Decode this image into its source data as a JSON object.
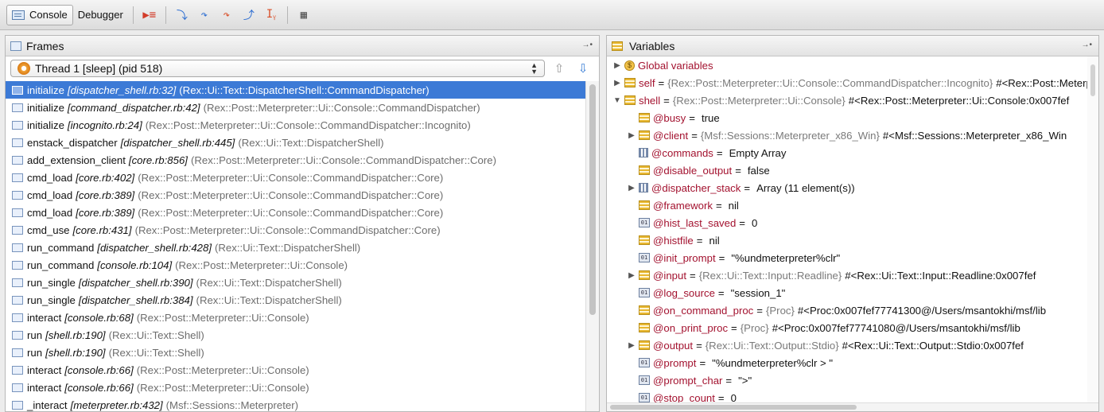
{
  "toolbar": {
    "tabs": [
      {
        "label": "Console",
        "icon": "console-icon",
        "active": true
      },
      {
        "label": "Debugger",
        "active": false
      }
    ],
    "buttons": [
      {
        "name": "run-to-cursor-button",
        "glyph": "▶≡",
        "color": "#d23c2a"
      },
      {
        "name": "step-into-button",
        "glyph": "⤵",
        "color": "#2f6fd2"
      },
      {
        "name": "step-over-button",
        "glyph": "↷",
        "color": "#2f6fd2"
      },
      {
        "name": "step-out-button",
        "glyph": "↷",
        "color": "#d9502a"
      },
      {
        "name": "step-out-frame-button",
        "glyph": "⤴",
        "color": "#2f6fd2"
      },
      {
        "name": "evaluate-expression-button",
        "glyph": "Iᵧ",
        "color": "#d9502a"
      },
      {
        "name": "calculator-button",
        "glyph": "▦",
        "color": "#555555"
      }
    ]
  },
  "frames_panel": {
    "title": "Frames",
    "thread": "Thread 1 [sleep] (pid 518)",
    "frames": [
      {
        "method": "initialize",
        "loc": "[dispatcher_shell.rb:32]",
        "cls": "(Rex::Ui::Text::DispatcherShell::CommandDispatcher)",
        "selected": true
      },
      {
        "method": "initialize",
        "loc": "[command_dispatcher.rb:42]",
        "cls": "(Rex::Post::Meterpreter::Ui::Console::CommandDispatcher)"
      },
      {
        "method": "initialize",
        "loc": "[incognito.rb:24]",
        "cls": "(Rex::Post::Meterpreter::Ui::Console::CommandDispatcher::Incognito)"
      },
      {
        "method": "enstack_dispatcher",
        "loc": "[dispatcher_shell.rb:445]",
        "cls": "(Rex::Ui::Text::DispatcherShell)"
      },
      {
        "method": "add_extension_client",
        "loc": "[core.rb:856]",
        "cls": "(Rex::Post::Meterpreter::Ui::Console::CommandDispatcher::Core)"
      },
      {
        "method": "cmd_load",
        "loc": "[core.rb:402]",
        "cls": "(Rex::Post::Meterpreter::Ui::Console::CommandDispatcher::Core)"
      },
      {
        "method": "cmd_load",
        "loc": "[core.rb:389]",
        "cls": "(Rex::Post::Meterpreter::Ui::Console::CommandDispatcher::Core)"
      },
      {
        "method": "cmd_load",
        "loc": "[core.rb:389]",
        "cls": "(Rex::Post::Meterpreter::Ui::Console::CommandDispatcher::Core)"
      },
      {
        "method": "cmd_use",
        "loc": "[core.rb:431]",
        "cls": "(Rex::Post::Meterpreter::Ui::Console::CommandDispatcher::Core)"
      },
      {
        "method": "run_command",
        "loc": "[dispatcher_shell.rb:428]",
        "cls": "(Rex::Ui::Text::DispatcherShell)"
      },
      {
        "method": "run_command",
        "loc": "[console.rb:104]",
        "cls": "(Rex::Post::Meterpreter::Ui::Console)"
      },
      {
        "method": "run_single",
        "loc": "[dispatcher_shell.rb:390]",
        "cls": "(Rex::Ui::Text::DispatcherShell)"
      },
      {
        "method": "run_single",
        "loc": "[dispatcher_shell.rb:384]",
        "cls": "(Rex::Ui::Text::DispatcherShell)"
      },
      {
        "method": "interact",
        "loc": "[console.rb:68]",
        "cls": "(Rex::Post::Meterpreter::Ui::Console)"
      },
      {
        "method": "run",
        "loc": "[shell.rb:190]",
        "cls": "(Rex::Ui::Text::Shell)"
      },
      {
        "method": "run",
        "loc": "[shell.rb:190]",
        "cls": "(Rex::Ui::Text::Shell)"
      },
      {
        "method": "interact",
        "loc": "[console.rb:66]",
        "cls": "(Rex::Post::Meterpreter::Ui::Console)"
      },
      {
        "method": "interact",
        "loc": "[console.rb:66]",
        "cls": "(Rex::Post::Meterpreter::Ui::Console)"
      },
      {
        "method": "_interact",
        "loc": "[meterpreter.rb:432]",
        "cls": "(Msf::Sessions::Meterpreter)"
      }
    ]
  },
  "variables_panel": {
    "title": "Variables",
    "vars": [
      {
        "depth": 0,
        "tri": "▶",
        "icon": "glob",
        "name": "Global variables"
      },
      {
        "depth": 0,
        "tri": "▶",
        "icon": "obj",
        "name": "self",
        "type": "{Rex::Post::Meterpreter::Ui::Console::CommandDispatcher::Incognito}",
        "value": "#<Rex::Post::Meterpreter::Ui::Console::CommandDispatcher::Incognito"
      },
      {
        "depth": 0,
        "tri": "▼",
        "icon": "obj",
        "name": "shell",
        "type": "{Rex::Post::Meterpreter::Ui::Console}",
        "value": "#<Rex::Post::Meterpreter::Ui::Console:0x007fef"
      },
      {
        "depth": 1,
        "tri": "",
        "icon": "obj",
        "name": "@busy",
        "value": "true"
      },
      {
        "depth": 1,
        "tri": "▶",
        "icon": "obj",
        "name": "@client",
        "type": "{Msf::Sessions::Meterpreter_x86_Win}",
        "value": "#<Msf::Sessions::Meterpreter_x86_Win"
      },
      {
        "depth": 1,
        "tri": "",
        "icon": "arr",
        "name": "@commands",
        "value": "Empty Array"
      },
      {
        "depth": 1,
        "tri": "",
        "icon": "obj",
        "name": "@disable_output",
        "value": "false"
      },
      {
        "depth": 1,
        "tri": "▶",
        "icon": "arr",
        "name": "@dispatcher_stack",
        "value": "Array (11 element(s))"
      },
      {
        "depth": 1,
        "tri": "",
        "icon": "obj",
        "name": "@framework",
        "value": "nil"
      },
      {
        "depth": 1,
        "tri": "",
        "icon": "str",
        "name": "@hist_last_saved",
        "value": "0"
      },
      {
        "depth": 1,
        "tri": "",
        "icon": "obj",
        "name": "@histfile",
        "value": "nil"
      },
      {
        "depth": 1,
        "tri": "",
        "icon": "str",
        "name": "@init_prompt",
        "value": "\"%undmeterpreter%clr\""
      },
      {
        "depth": 1,
        "tri": "▶",
        "icon": "obj",
        "name": "@input",
        "type": "{Rex::Ui::Text::Input::Readline}",
        "value": "#<Rex::Ui::Text::Input::Readline:0x007fef"
      },
      {
        "depth": 1,
        "tri": "",
        "icon": "str",
        "name": "@log_source",
        "value": "\"session_1\""
      },
      {
        "depth": 1,
        "tri": "",
        "icon": "obj",
        "name": "@on_command_proc",
        "type": "{Proc}",
        "value": "#<Proc:0x007fef77741300@/Users/msantokhi/msf/lib"
      },
      {
        "depth": 1,
        "tri": "",
        "icon": "obj",
        "name": "@on_print_proc",
        "type": "{Proc}",
        "value": "#<Proc:0x007fef77741080@/Users/msantokhi/msf/lib"
      },
      {
        "depth": 1,
        "tri": "▶",
        "icon": "obj",
        "name": "@output",
        "type": "{Rex::Ui::Text::Output::Stdio}",
        "value": "#<Rex::Ui::Text::Output::Stdio:0x007fef"
      },
      {
        "depth": 1,
        "tri": "",
        "icon": "str",
        "name": "@prompt",
        "value": "\"%undmeterpreter%clr > \""
      },
      {
        "depth": 1,
        "tri": "",
        "icon": "str",
        "name": "@prompt_char",
        "value": "\">\""
      },
      {
        "depth": 1,
        "tri": "",
        "icon": "str",
        "name": "@stop_count",
        "value": "0"
      }
    ]
  }
}
